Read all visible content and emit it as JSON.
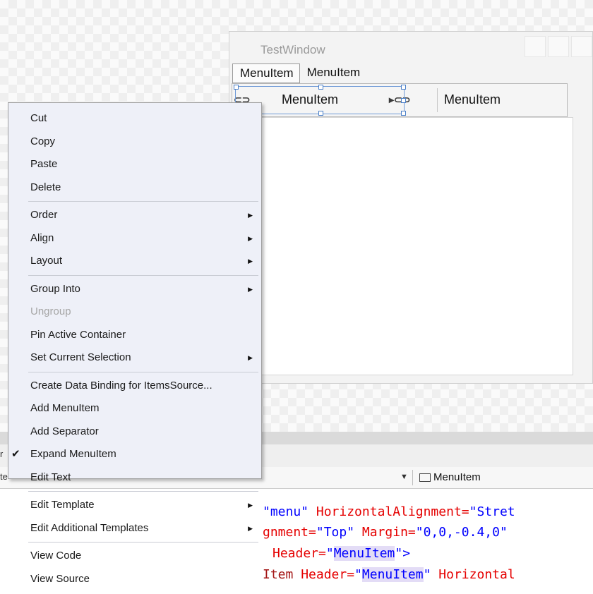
{
  "window": {
    "title": "TestWindow",
    "top_menu": [
      "MenuItem",
      "MenuItem"
    ],
    "sub_menu": [
      "MenuItem",
      "MenuItem"
    ]
  },
  "context_menu": {
    "groups": [
      [
        {
          "label": "Cut"
        },
        {
          "label": "Copy"
        },
        {
          "label": "Paste"
        },
        {
          "label": "Delete"
        }
      ],
      [
        {
          "label": "Order",
          "submenu": true
        },
        {
          "label": "Align",
          "submenu": true
        },
        {
          "label": "Layout",
          "submenu": true
        }
      ],
      [
        {
          "label": "Group Into",
          "submenu": true
        },
        {
          "label": "Ungroup",
          "disabled": true
        },
        {
          "label": "Pin Active Container"
        },
        {
          "label": "Set Current Selection",
          "submenu": true
        }
      ],
      [
        {
          "label": "Create Data Binding for ItemsSource..."
        },
        {
          "label": "Add MenuItem"
        },
        {
          "label": "Add Separator"
        },
        {
          "label": "Expand MenuItem",
          "checked": true
        },
        {
          "label": "Edit Text"
        }
      ],
      [
        {
          "label": "Edit Template",
          "submenu": true
        },
        {
          "label": "Edit Additional Templates",
          "submenu": true
        }
      ],
      [
        {
          "label": "View Code"
        },
        {
          "label": "View Source"
        }
      ]
    ]
  },
  "breadcrumb": {
    "selected_element": "MenuItem"
  },
  "code": {
    "line1": {
      "str": "\"menu\"",
      "attr": "HorizontalAlignment=",
      "val": "\"Stret"
    },
    "line2": {
      "attr": "gnment=",
      "val1": "\"Top\"",
      "attr2": "Margin=",
      "val2": "\"0,0,-0.4,0\""
    },
    "line3": {
      "attr": "Header=",
      "q": "\"",
      "hl": "MenuItem",
      "tail": "\">"
    },
    "line4": {
      "elem": "Item",
      "attr": "Header=",
      "q": "\"",
      "hl": "MenuItem",
      "q2": "\"",
      "attr2": "Horizontal"
    }
  },
  "left_stubs": [
    "r",
    "te"
  ]
}
